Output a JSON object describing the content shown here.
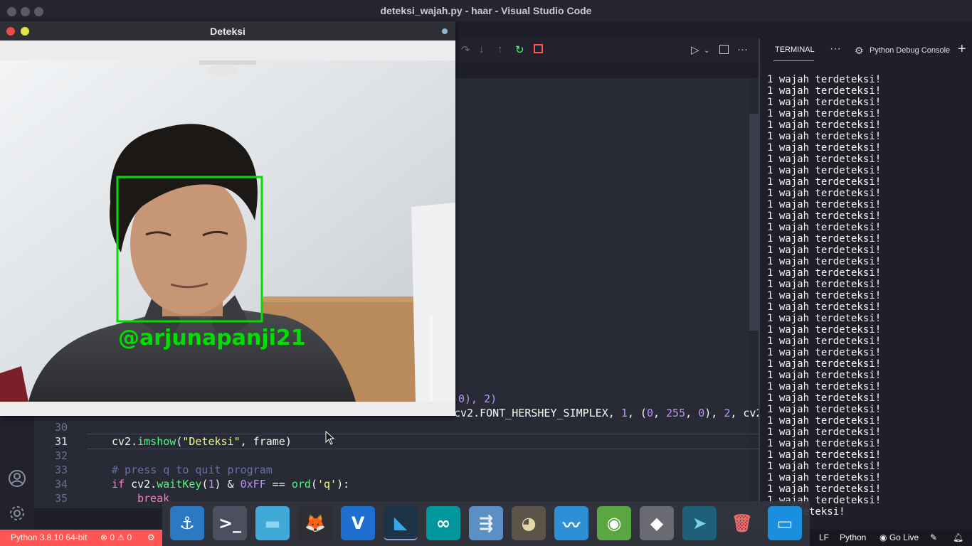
{
  "window_title": "deteksi_wajah.py - haar - Visual Studio Code",
  "deteksi_window": {
    "title": "Deteksi",
    "overlay_label": "@arjunapanji21"
  },
  "editor": {
    "partial_line_28": "0), 2)",
    "partial_line_29_a": "cv2.FONT_HERSHEY_SIMPLEX, ",
    "partial_line_29_b": "1",
    "partial_line_29_c": ", (",
    "partial_line_29_d": "0",
    "partial_line_29_e": ", ",
    "partial_line_29_f": "255",
    "partial_line_29_g": ", ",
    "partial_line_29_h": "0",
    "partial_line_29_i": "), ",
    "partial_line_29_j": "2",
    "partial_line_29_k": ", cv2",
    "line_numbers": [
      "30",
      "31",
      "32",
      "33",
      "34",
      "35"
    ],
    "line31": {
      "obj": "cv2.",
      "fn": "imshow",
      "p1": "(",
      "str": "\"Deteksi\"",
      "rest": ", frame)"
    },
    "line33": "# press q to quit program",
    "line34": {
      "kw": "if",
      "obj": " cv2.",
      "fn": "waitKey",
      "a": "(",
      "num1": "1",
      "b": ") & ",
      "num2": "0xFF",
      "c": " == ",
      "fn2": "ord",
      "d": "(",
      "str": "'q'",
      "e": "):"
    },
    "line35": "break"
  },
  "terminal": {
    "tab_label": "TERMINAL",
    "more": "···",
    "debug_console": "Python Debug Console",
    "add": "+",
    "output_line": "1 wajah terdeteksi!",
    "line_count": 39,
    "partial_last_line": "terdeteksi!"
  },
  "statusbar": {
    "python_version": "Python 3.8.10 64-bit",
    "errors": "0",
    "warnings": "0",
    "eol": "LF",
    "language": "Python",
    "go_live": "Go Live"
  },
  "dock_apps": [
    "anchor-icon",
    "terminal-icon",
    "files-icon",
    "gitkraken-icon",
    "vnc-viewer-icon",
    "vscode-icon",
    "arduino-icon",
    "meld-icon",
    "gimp-icon",
    "pulse-icon",
    "android-studio-icon",
    "settings-icon",
    "deploy-icon",
    "trash-icon",
    "window-icon"
  ],
  "colors": {
    "accent_pink": "#ff79c6",
    "face_box_green": "#00e000",
    "status_red": "#ff5555"
  }
}
